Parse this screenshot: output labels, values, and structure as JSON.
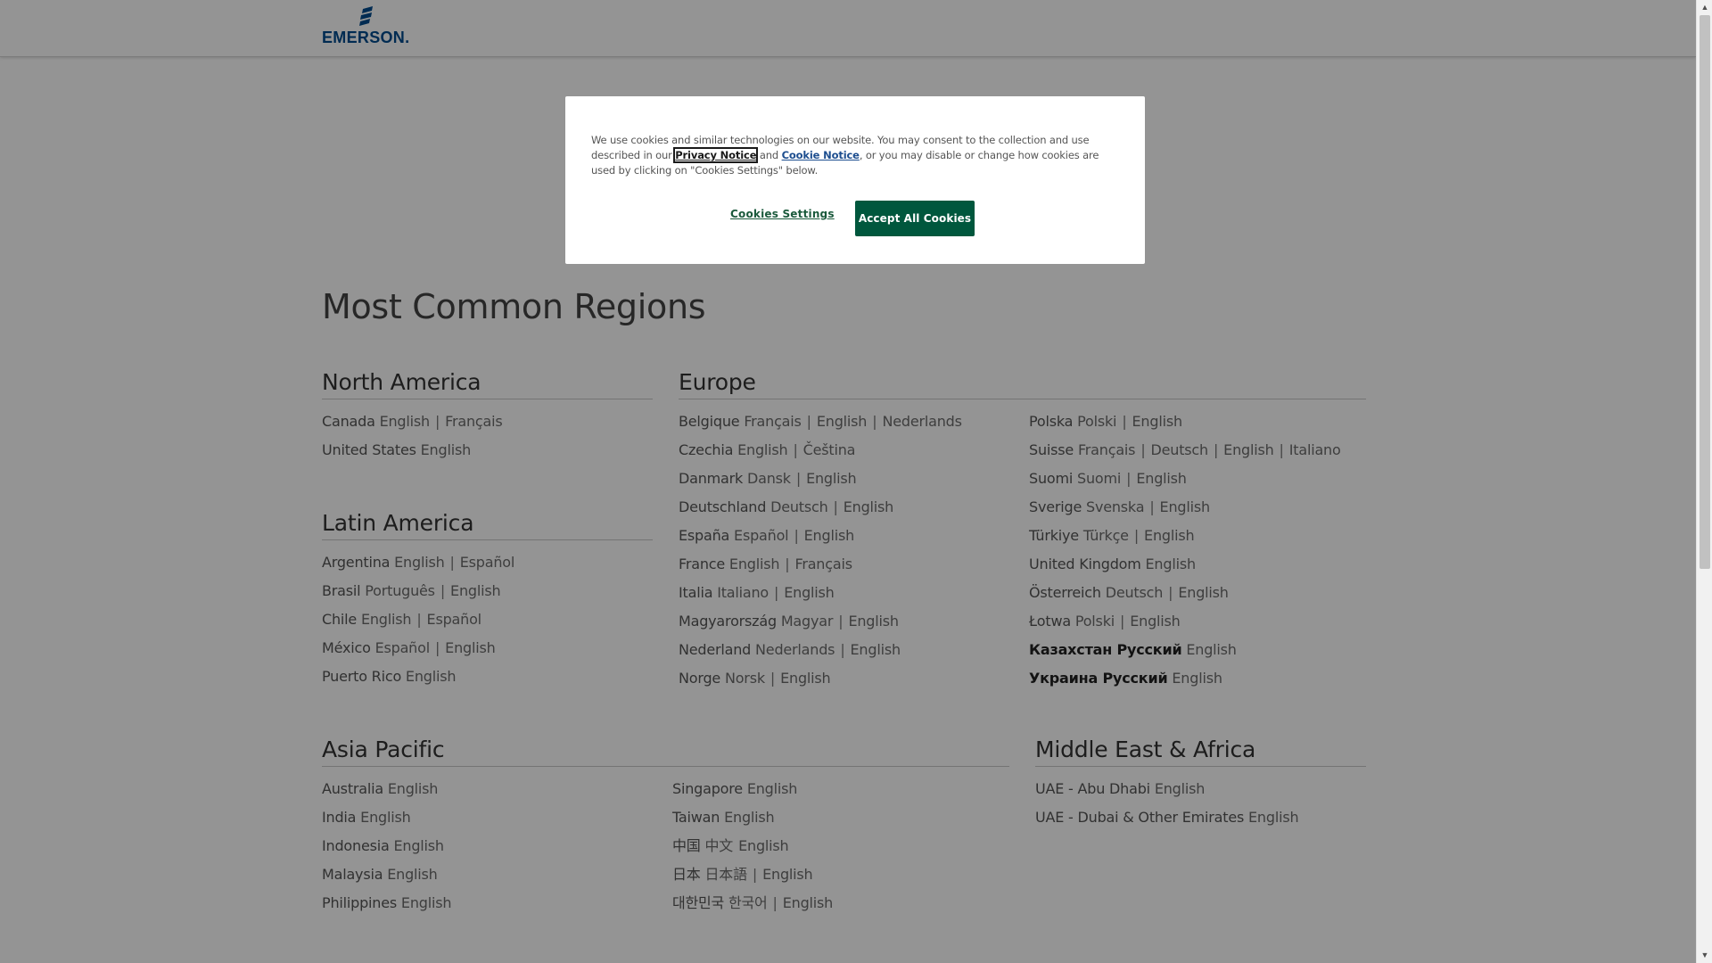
{
  "header": {
    "logo_text": "EMERSON."
  },
  "main_title": "Most Common Regions",
  "regions": {
    "north_america": {
      "heading": "North America",
      "countries": [
        {
          "name": "Canada",
          "langs": [
            "English",
            "Français"
          ]
        },
        {
          "name": "United States",
          "langs": [
            "English"
          ]
        }
      ]
    },
    "europe": {
      "heading": "Europe",
      "col1": [
        {
          "name": "Belgique",
          "langs": [
            "Français",
            "English",
            "Nederlands"
          ]
        },
        {
          "name": "Czechia",
          "langs": [
            "English",
            "Čeština"
          ]
        },
        {
          "name": "Danmark",
          "langs": [
            "Dansk",
            "English"
          ]
        },
        {
          "name": "Deutschland",
          "langs": [
            "Deutsch",
            "English"
          ]
        },
        {
          "name": "España",
          "langs": [
            "Español",
            "English"
          ]
        },
        {
          "name": "France",
          "langs": [
            "English",
            "Français"
          ]
        },
        {
          "name": "Italia",
          "langs": [
            "Italiano",
            "English"
          ]
        },
        {
          "name": "Magyarország",
          "langs": [
            "Magyar",
            "English"
          ]
        },
        {
          "name": "Nederland",
          "langs": [
            "Nederlands",
            "English"
          ]
        },
        {
          "name": "Norge",
          "langs": [
            "Norsk",
            "English"
          ]
        }
      ],
      "col2": [
        {
          "name": "Polska",
          "langs": [
            "Polski",
            "English"
          ]
        },
        {
          "name": "Suisse",
          "langs": [
            "Français",
            "Deutsch",
            "English",
            "Italiano"
          ]
        },
        {
          "name": "Suomi",
          "langs": [
            "Suomi",
            "English"
          ]
        },
        {
          "name": "Sverige",
          "langs": [
            "Svenska",
            "English"
          ]
        },
        {
          "name": "Türkiye",
          "langs": [
            "Türkçe",
            "English"
          ]
        },
        {
          "name": "United Kingdom",
          "langs": [
            "English"
          ]
        },
        {
          "name": "Österreich",
          "langs": [
            "Deutsch",
            "English"
          ]
        },
        {
          "name": "Łotwa",
          "langs": [
            "Polski",
            "English"
          ]
        },
        {
          "name": "Казахстан Русский",
          "langs": [
            "English"
          ],
          "dark": true
        },
        {
          "name": "Украина Русский",
          "langs": [
            "English"
          ],
          "dark": true
        }
      ]
    },
    "latin_america": {
      "heading": "Latin America",
      "countries": [
        {
          "name": "Argentina",
          "langs": [
            "English",
            "Español"
          ]
        },
        {
          "name": "Brasil",
          "langs": [
            "Português",
            "English"
          ]
        },
        {
          "name": "Chile",
          "langs": [
            "English",
            "Español"
          ]
        },
        {
          "name": "México",
          "langs": [
            "Español",
            "English"
          ]
        },
        {
          "name": "Puerto Rico",
          "langs": [
            "English"
          ]
        }
      ]
    },
    "asia_pacific": {
      "heading": "Asia Pacific",
      "col1": [
        {
          "name": "Australia",
          "langs": [
            "English"
          ]
        },
        {
          "name": "India",
          "langs": [
            "English"
          ]
        },
        {
          "name": "Indonesia",
          "langs": [
            "English"
          ]
        },
        {
          "name": "Malaysia",
          "langs": [
            "English"
          ]
        },
        {
          "name": "Philippines",
          "langs": [
            "English"
          ]
        }
      ],
      "col2": [
        {
          "name": "Singapore",
          "langs": [
            "English"
          ]
        },
        {
          "name": "Taiwan",
          "langs": [
            "English"
          ]
        },
        {
          "name": "中国",
          "langs": [
            "中文",
            "English"
          ],
          "join": " "
        },
        {
          "name": "日本",
          "langs": [
            "日本語",
            "English"
          ]
        },
        {
          "name": "대한민국",
          "langs": [
            "한국어",
            "English"
          ]
        }
      ]
    },
    "middle_east_africa": {
      "heading": "Middle East & Africa",
      "countries": [
        {
          "name": "UAE - Abu Dhabi",
          "langs": [
            "English"
          ]
        },
        {
          "name": "UAE - Dubai & Other Emirates",
          "langs": [
            "English"
          ]
        }
      ]
    }
  },
  "cookie_dialog": {
    "text_before": "We use cookies and similar technologies on our website. You may consent to the collection and use described in our ",
    "privacy_link": "Privacy Notice",
    "text_and": " and ",
    "cookie_link": "Cookie Notice",
    "text_after": ", or you may disable or change how cookies are used by clicking on \"Cookies Settings\" below.",
    "settings_label": "Cookies Settings",
    "accept_label": "Accept All Cookies"
  }
}
